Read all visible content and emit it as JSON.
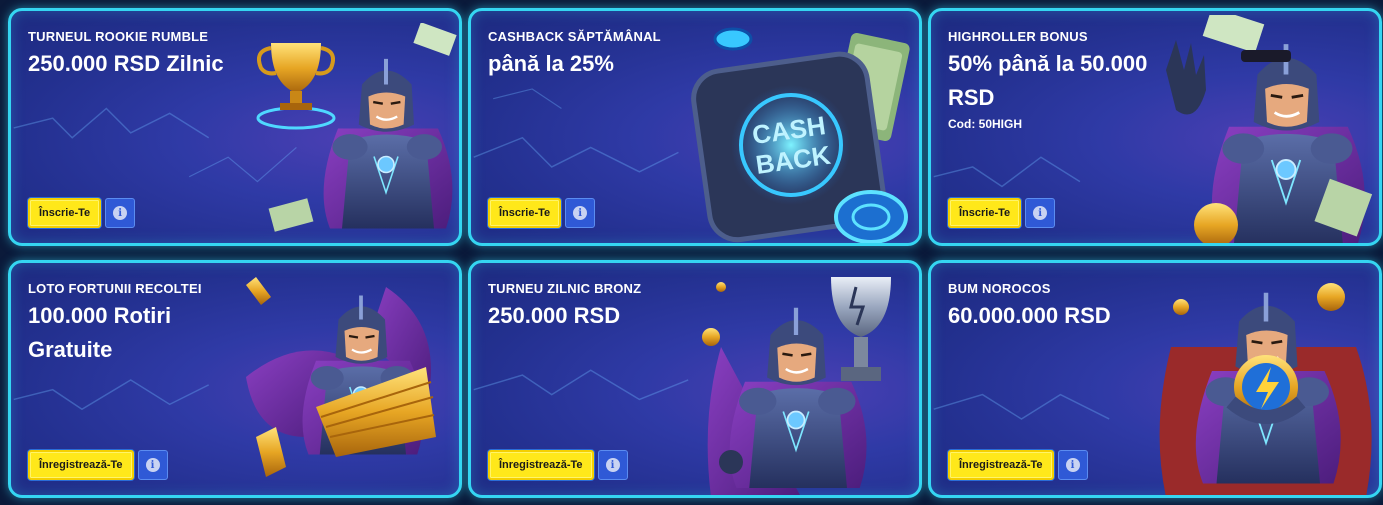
{
  "promos": [
    {
      "eyebrow": "TURNEUL ROOKIE RUMBLE",
      "headline": "250.000 RSD Zilnic",
      "code": "",
      "cta": "Înscrie-Te",
      "art_icon": "hero-trophy-icon"
    },
    {
      "eyebrow": "CASHBACK SĂPTĂMÂNAL",
      "headline": "până la 25%",
      "code": "",
      "cta": "Înscrie-Te",
      "art_icon": "cashback-device-icon",
      "art_text_1": "CASH",
      "art_text_2": "BACK"
    },
    {
      "eyebrow": "HIGHROLLER BONUS",
      "headline": "50% până la 50.000 RSD",
      "code": "Cod: 50HIGH",
      "cta": "Înscrie-Te",
      "art_icon": "hero-waving-icon"
    },
    {
      "eyebrow": "LOTO FORTUNII RECOLTEI",
      "headline": "100.000 Rotiri Gratuite",
      "code": "",
      "cta": "Înregistrează-Te",
      "art_icon": "hero-tickets-icon"
    },
    {
      "eyebrow": "TURNEU ZILNIC BRONZ",
      "headline": "250.000 RSD",
      "code": "",
      "cta": "Înregistrează-Te",
      "art_icon": "hero-silver-trophy-icon"
    },
    {
      "eyebrow": "BUM NOROCOS",
      "headline": "60.000.000 RSD",
      "code": "",
      "cta": "Înregistrează-Te",
      "art_icon": "hero-lightning-orb-icon"
    }
  ],
  "info_icon": "i",
  "colors": {
    "border": "#35d6f2",
    "cta_bg": "#ffe81a",
    "info_bg": "#2f59d6",
    "card_bg": "#2a349c"
  }
}
